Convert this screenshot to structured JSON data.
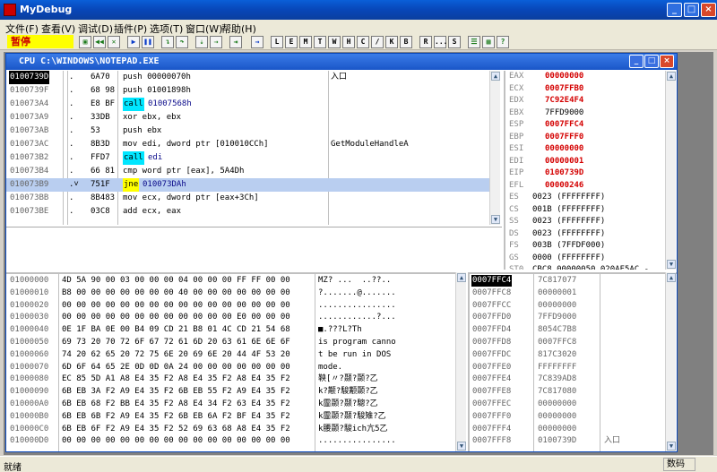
{
  "app": {
    "title": "MyDebug"
  },
  "window_buttons": [
    "_",
    "□",
    "×"
  ],
  "menu": [
    "文件(F)",
    "查看(V)",
    "调试(D)",
    "插件(P)",
    "选项(T)",
    "窗口(W)",
    "帮助(H)"
  ],
  "toolbar": {
    "status": "暂停",
    "letters": [
      "L",
      "E",
      "M",
      "T",
      "W",
      "H",
      "C",
      "/",
      "K",
      "B",
      "R",
      "...",
      "S"
    ]
  },
  "cpu": {
    "title": "CPU C:\\WINDOWS\\NOTEPAD.EXE",
    "disasm": [
      {
        "addr": "0100739D",
        "mark": ".",
        "hex": "6A70",
        "instr": "push 00000070h",
        "comment": "入口",
        "current": true
      },
      {
        "addr": "0100739F",
        "mark": ".",
        "hex": "68 98",
        "instr": "push 01001898h",
        "comment": ""
      },
      {
        "addr": "010073A4",
        "mark": ".",
        "hex": "E8 BF",
        "instr": "call 01007568h",
        "comment": "",
        "kw": "call"
      },
      {
        "addr": "010073A9",
        "mark": ".",
        "hex": "33DB",
        "instr": "xor ebx, ebx",
        "comment": ""
      },
      {
        "addr": "010073AB",
        "mark": ".",
        "hex": "53",
        "instr": "push ebx",
        "comment": ""
      },
      {
        "addr": "010073AC",
        "mark": ".",
        "hex": "8B3D",
        "instr": "mov edi, dword ptr [010010CCh]",
        "comment": "GetModuleHandleA"
      },
      {
        "addr": "010073B2",
        "mark": ".",
        "hex": "FFD7",
        "instr": "call edi",
        "comment": "",
        "kw": "call"
      },
      {
        "addr": "010073B4",
        "mark": ".",
        "hex": "66 81",
        "instr": "cmp word ptr [eax], 5A4Dh",
        "comment": ""
      },
      {
        "addr": "010073B9",
        "mark": ".˅",
        "hex": "751F",
        "instr": "jne 010073DAh",
        "comment": "",
        "kw": "jne",
        "selected": true
      },
      {
        "addr": "010073BB",
        "mark": ".",
        "hex": "8B483",
        "instr": "mov ecx, dword ptr [eax+3Ch]",
        "comment": ""
      },
      {
        "addr": "010073BE",
        "mark": ".",
        "hex": "03C8",
        "instr": "add ecx, eax",
        "comment": ""
      }
    ],
    "registers": [
      {
        "name": "EAX",
        "value": "00000000",
        "style": "red"
      },
      {
        "name": "ECX",
        "value": "0007FFB0",
        "style": "red"
      },
      {
        "name": "EDX",
        "value": "7C92E4F4",
        "style": "red"
      },
      {
        "name": "EBX",
        "value": "7FFD9000",
        "style": "normal"
      },
      {
        "name": "ESP",
        "value": "0007FFC4",
        "style": "red"
      },
      {
        "name": "EBP",
        "value": "0007FFF0",
        "style": "red"
      },
      {
        "name": "ESI",
        "value": "00000000",
        "style": "red"
      },
      {
        "name": "EDI",
        "value": "00000001",
        "style": "red"
      },
      {
        "name": "EIP",
        "value": "0100739D",
        "style": "red"
      },
      {
        "name": "EFL",
        "value": "00000246",
        "style": "red"
      },
      {
        "name": "ES",
        "value": "0023 (FFFFFFFF)",
        "style": "normal"
      },
      {
        "name": "CS",
        "value": "001B (FFFFFFFF)",
        "style": "normal"
      },
      {
        "name": "SS",
        "value": "0023 (FFFFFFFF)",
        "style": "normal"
      },
      {
        "name": "DS",
        "value": "0023 (FFFFFFFF)",
        "style": "normal"
      },
      {
        "name": "FS",
        "value": "003B (7FFDF000)",
        "style": "normal"
      },
      {
        "name": "GS",
        "value": "0000 (FFFFFFFF)",
        "style": "normal"
      },
      {
        "name": "ST0",
        "value": "CBC8 00000050 020AF5AC -",
        "style": "normal"
      }
    ],
    "dump": [
      {
        "addr": "01000000",
        "hex": "4D 5A 90 00 03 00 00 00 04 00 00 00 FF FF 00 00",
        "ascii": "MZ? ...  ..??.."
      },
      {
        "addr": "01000010",
        "hex": "B8 00 00 00 00 00 00 00 40 00 00 00 00 00 00 00",
        "ascii": "?.......@......."
      },
      {
        "addr": "01000020",
        "hex": "00 00 00 00 00 00 00 00 00 00 00 00 00 00 00 00",
        "ascii": "................"
      },
      {
        "addr": "01000030",
        "hex": "00 00 00 00 00 00 00 00 00 00 00 00 E0 00 00 00",
        "ascii": "............?..."
      },
      {
        "addr": "01000040",
        "hex": "0E 1F BA 0E 00 B4 09 CD 21 B8 01 4C CD 21 54 68",
        "ascii": "■.???L?Th"
      },
      {
        "addr": "01000050",
        "hex": "69 73 20 70 72 6F 67 72 61 6D 20 63 61 6E 6E 6F",
        "ascii": "is program canno"
      },
      {
        "addr": "01000060",
        "hex": "74 20 62 65 20 72 75 6E 20 69 6E 20 44 4F 53 20",
        "ascii": "t be run in DOS "
      },
      {
        "addr": "01000070",
        "hex": "6D 6F 64 65 2E 0D 0D 0A 24 00 00 00 00 00 00 00",
        "ascii": "mode."
      },
      {
        "addr": "01000080",
        "hex": "EC 85 5D A1 A8 E4 35 F2 A8 E4 35 F2 A8 E4 35 F2",
        "ascii": "鞅[〃?颞?颞?乙"
      },
      {
        "addr": "01000090",
        "hex": "6B EB 3A F2 A9 E4 35 F2 6B EB 55 F2 A9 E4 35 F2",
        "ascii": "k?颟?駿颟颞?乙"
      },
      {
        "addr": "010000A0",
        "hex": "6B EB 68 F2 BB E4 35 F2 A8 E4 34 F2 63 E4 35 F2",
        "ascii": "k霝颞?颞?驄?乙"
      },
      {
        "addr": "010000B0",
        "hex": "6B EB 6B F2 A9 E4 35 F2 6B EB 6A F2 BF E4 35 F2",
        "ascii": "k霝颞?颞?駿雉?乙"
      },
      {
        "addr": "010000C0",
        "hex": "6B EB 6F F2 A9 E4 35 F2 52 69 63 68 A8 E4 35 F2",
        "ascii": "k腰颞?駿ich亢5乙"
      },
      {
        "addr": "010000D0",
        "hex": "00 00 00 00 00 00 00 00 00 00 00 00 00 00 00 00",
        "ascii": "................"
      }
    ],
    "stack": [
      {
        "addr": "0007FFC4",
        "value": "7C817077",
        "comment": "",
        "current": true
      },
      {
        "addr": "0007FFC8",
        "value": "00000001",
        "comment": ""
      },
      {
        "addr": "0007FFCC",
        "value": "00000000",
        "comment": ""
      },
      {
        "addr": "0007FFD0",
        "value": "7FFD9000",
        "comment": ""
      },
      {
        "addr": "0007FFD4",
        "value": "8054C7B8",
        "comment": ""
      },
      {
        "addr": "0007FFD8",
        "value": "0007FFC8",
        "comment": ""
      },
      {
        "addr": "0007FFDC",
        "value": "817C3020",
        "comment": ""
      },
      {
        "addr": "0007FFE0",
        "value": "FFFFFFFF",
        "comment": ""
      },
      {
        "addr": "0007FFE4",
        "value": "7C839AD8",
        "comment": ""
      },
      {
        "addr": "0007FFE8",
        "value": "7C817080",
        "comment": ""
      },
      {
        "addr": "0007FFEC",
        "value": "00000000",
        "comment": ""
      },
      {
        "addr": "0007FFF0",
        "value": "00000000",
        "comment": ""
      },
      {
        "addr": "0007FFF4",
        "value": "00000000",
        "comment": ""
      },
      {
        "addr": "0007FFF8",
        "value": "0100739D",
        "comment": "入口"
      }
    ]
  },
  "statusbar": {
    "left": "就绪",
    "right": "数码"
  }
}
